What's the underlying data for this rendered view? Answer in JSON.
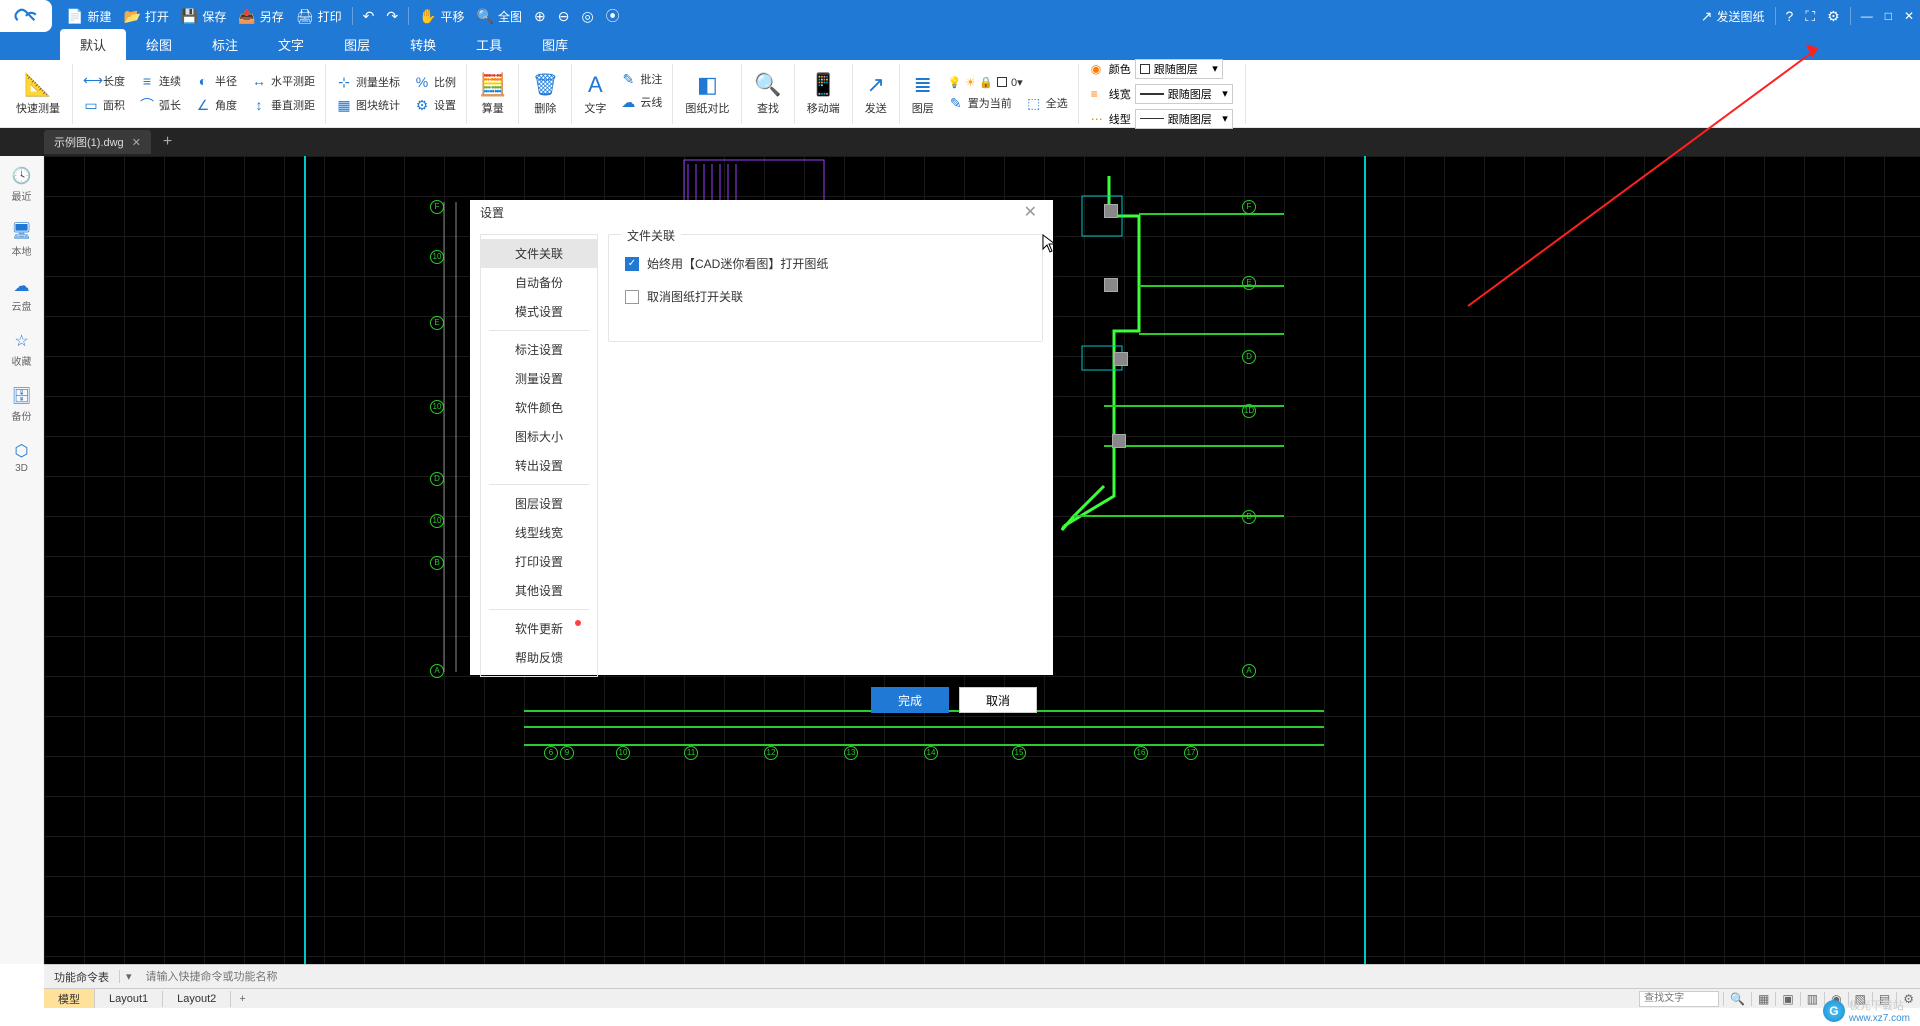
{
  "titlebar": {
    "actions": {
      "new": "新建",
      "open": "打开",
      "save": "保存",
      "saveas": "另存",
      "print": "打印",
      "pan": "平移",
      "full": "全图",
      "send_drawing": "发送图纸"
    }
  },
  "menutabs": {
    "items": [
      "默认",
      "绘图",
      "标注",
      "文字",
      "图层",
      "转换",
      "工具",
      "图库"
    ],
    "active": 0
  },
  "ribbon": {
    "quick_measure": "快速测量",
    "g1": {
      "length": "长度",
      "continuous": "连续",
      "radius": "半径",
      "hdist": "水平测距",
      "area": "面积",
      "arc": "弧长",
      "angle": "角度",
      "vdist": "垂直测距"
    },
    "g2": {
      "coord": "测量坐标",
      "scale": "比例",
      "blockstat": "图块统计",
      "settings": "设置"
    },
    "calc": "算量",
    "delete": "删除",
    "text": "文字",
    "annotate": "批注",
    "cloud": "云线",
    "compare": "图纸对比",
    "find": "查找",
    "mobile": "移动端",
    "send": "发送",
    "layer": "图层",
    "set_current": "置为当前",
    "select_all": "全选",
    "props": {
      "color": "颜色",
      "linewidth": "线宽",
      "linetype": "线型",
      "follow": "跟随图层"
    },
    "layer_value": "0"
  },
  "doctabs": {
    "open": "示例图(1).dwg"
  },
  "leftbar": {
    "recent": "最近",
    "local": "本地",
    "cloud": "云盘",
    "favorite": "收藏",
    "backup": "备份",
    "td": "3D"
  },
  "dialog": {
    "title": "设置",
    "nav": [
      "文件关联",
      "自动备份",
      "模式设置",
      "标注设置",
      "测量设置",
      "软件颜色",
      "图标大小",
      "转出设置",
      "图层设置",
      "线型线宽",
      "打印设置",
      "其他设置",
      "软件更新",
      "帮助反馈"
    ],
    "nav_groups_after": [
      2,
      7,
      11
    ],
    "nav_dot": 12,
    "section_title": "文件关联",
    "chk1": "始终用【CAD迷你看图】打开图纸",
    "chk2": "取消图纸打开关联",
    "ok": "完成",
    "cancel": "取消"
  },
  "cmdbar": {
    "label": "功能命令表",
    "placeholder": "请输入快捷命令或功能名称"
  },
  "layouts": {
    "tabs": [
      "模型",
      "Layout1",
      "Layout2"
    ],
    "active": 0,
    "search_placeholder": "查找文字"
  },
  "watermark": {
    "text": "极光下载站",
    "url": "www.xz7.com"
  }
}
